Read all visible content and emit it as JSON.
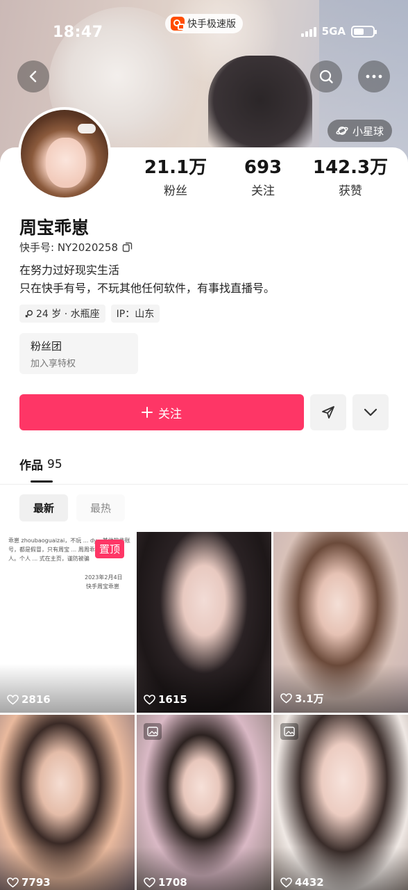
{
  "status_bar": {
    "time": "18:47",
    "app_badge": "快手极速版",
    "network": "5GA"
  },
  "header": {
    "planet_chip": "小星球",
    "icons": [
      "back-arrow-icon",
      "search-icon",
      "more-icon",
      "planet-icon"
    ]
  },
  "profile": {
    "name": "周宝乖崽",
    "account_label": "快手号: NY2020258",
    "bio_line1": "在努力过好现实生活",
    "bio_line2": "只在快手有号，不玩其他任何软件，有事找直播号。",
    "tag_age": "24 岁 · 水瓶座",
    "tag_ip": "IP：山东"
  },
  "stats": [
    {
      "value": "21.1万",
      "label": "粉丝"
    },
    {
      "value": "693",
      "label": "关注"
    },
    {
      "value": "142.3万",
      "label": "获赞"
    }
  ],
  "fanclub": {
    "title": "粉丝团",
    "subtitle": "加入享特权"
  },
  "actions": {
    "follow_label": "关注"
  },
  "tabs": {
    "works_label": "作品",
    "works_count": "95"
  },
  "sort": {
    "latest": "最新",
    "hot": "最热"
  },
  "notice_card": {
    "text": "乖崽 zhoubaoguaizai，不玩 ... dy，其他软件账号，都是假冒，只有周宝 ... 周周乖崽也不是本人。个人 ... 式在主页，谨防被骗",
    "date": "2023年2月4日",
    "signature": "快手周宝乖崽",
    "pin_label": "置顶"
  },
  "videos": [
    {
      "likes": "2816"
    },
    {
      "likes": "1615"
    },
    {
      "likes": "3.1万"
    },
    {
      "likes": "7793"
    },
    {
      "likes": "1708"
    },
    {
      "likes": "4432"
    }
  ]
}
